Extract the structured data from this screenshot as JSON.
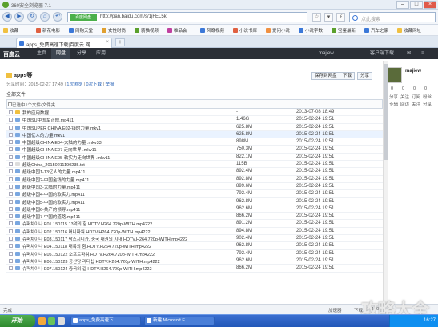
{
  "window": {
    "title": "360安全浏览器 7.1"
  },
  "address": {
    "secure_badge": "百度网盘",
    "url": "http://pan.baidu.com/s/1jFEL5k",
    "search_placeholder": "点此搜索"
  },
  "favorites": [
    "收藏",
    "新花电影",
    "网购天堂",
    "女性时尚",
    "骑猫视频",
    "唯品会",
    "风靡视频",
    "小说书库",
    "爱问小说",
    "小说字数",
    "宝鉴最新",
    "汽车之家",
    "收藏网址"
  ],
  "tab": {
    "label": "apps_免费高速下载|百度云 网"
  },
  "baidu_nav": {
    "logo": "百度云",
    "items": [
      "主页",
      "网盘",
      "分享",
      "应用"
    ],
    "active": 1,
    "user": "majiew",
    "right": [
      "客户端下载",
      "✉",
      "≡"
    ]
  },
  "share": {
    "title": "apps等",
    "meta_prefix": "分享时间：2015-02-27 17:49 | ",
    "meta_a": "1次浏览",
    "meta_b": "0次下载",
    "meta_c": "举报",
    "buttons": [
      "保存到网盘",
      "下载",
      "分享"
    ],
    "all_files": "全部文件",
    "selected": "已选中1个文件/文件夹"
  },
  "files": [
    {
      "name": "我的应用数据",
      "size": "-",
      "date": "2013-07-08 18:49",
      "color": "#f0c040",
      "hl": false
    },
    {
      "name": "中国SU中国军正规.mp411",
      "size": "1.46G",
      "date": "2015-02-24 19:51",
      "color": "#7aa7e0",
      "hl": false
    },
    {
      "name": "中国SUPER CHINA E02-钱的力量.mkv1",
      "size": "625.8M",
      "date": "2015-02-24 19:51",
      "color": "#7aa7e0",
      "hl": false
    },
    {
      "name": "中国亿人的力量.mkv1",
      "size": "625.8M",
      "date": "2015-02-24 19:51",
      "color": "#7aa7e0",
      "hl": true
    },
    {
      "name": "中国超级CHINA E04-大陆的力量 .mkv33",
      "size": "898M",
      "date": "2015-02-24 19:51",
      "color": "#7aa7e0",
      "hl": false
    },
    {
      "name": "中国超级CHINA E07 走向世界 .mkv11",
      "size": "750.3M",
      "date": "2015-02-24 19:51",
      "color": "#7aa7e0",
      "hl": false
    },
    {
      "name": "中国超级CHINA E05-软实力走向世界 .mkv11",
      "size": "822.1M",
      "date": "2015-02-24 19:51",
      "color": "#7aa7e0",
      "hl": false
    },
    {
      "name": "超级China_20150211190235.txt",
      "size": "115B",
      "date": "2015-02-24 19:51",
      "color": "#dddddd",
      "hl": false
    },
    {
      "name": "超级中国1-13亿人的力量.mp411",
      "size": "892.4M",
      "date": "2015-02-24 19:51",
      "color": "#7aa7e0",
      "hl": false
    },
    {
      "name": "超级中国2-中国金钱的力量.mp411",
      "size": "892.8M",
      "date": "2015-02-24 19:51",
      "color": "#7aa7e0",
      "hl": false
    },
    {
      "name": "超级中国3-大陆的力量.mp411",
      "size": "899.6M",
      "date": "2015-02-24 19:51",
      "color": "#7aa7e0",
      "hl": false
    },
    {
      "name": "超级中国4-中国的软实力.mp411",
      "size": "792.4M",
      "date": "2015-02-24 19:51",
      "color": "#7aa7e0",
      "hl": false
    },
    {
      "name": "超级中国5-中国的软实力.mp411",
      "size": "962.8M",
      "date": "2015-02-24 19:51",
      "color": "#7aa7e0",
      "hl": false
    },
    {
      "name": "超级中国6-共产的领导.mp411",
      "size": "962.6M",
      "date": "2015-02-24 19:51",
      "color": "#7aa7e0",
      "hl": false
    },
    {
      "name": "超级中国7-中国的道路.mp411",
      "size": "866.2M",
      "date": "2015-02-24 19:51",
      "color": "#7aa7e0",
      "hl": false
    },
    {
      "name": "슈퍼차이나 E01.150115 13억의 힘.HDTV.H264.720p-WITH.mp4222",
      "size": "891.2M",
      "date": "2015-02-24 19:51",
      "color": "#7aa7e0",
      "hl": false
    },
    {
      "name": "슈퍼차이나 E02.150116 머니파워.HDTV.H264.720p-WITH.mp4222",
      "size": "894.8M",
      "date": "2015-02-24 19:51",
      "color": "#7aa7e0",
      "hl": false
    },
    {
      "name": "슈퍼차이나 E03.150117 팍스시니카, 중국 패권의 시대 HDTV.H264.720p-WITH.mp4222",
      "size": "902.4M",
      "date": "2015-02-24 19:51",
      "color": "#7aa7e0",
      "hl": false
    },
    {
      "name": "슈퍼차이나 E04.150118 대륙의 힘.HDTV.H264.720p-WITH.mp4222",
      "size": "962.8M",
      "date": "2015-02-24 19:51",
      "color": "#7aa7e0",
      "hl": false
    },
    {
      "name": "슈퍼차이나 E05.150122 소프트파워.HDTV.H264.720p-WITH.mp4222",
      "size": "792.4M",
      "date": "2015-02-24 19:51",
      "color": "#7aa7e0",
      "hl": false
    },
    {
      "name": "슈퍼차이나 E06.150123 공산당 리더십 HDTV.H264.720p-WITH.mp4222",
      "size": "962.6M",
      "date": "2015-02-24 19:51",
      "color": "#7aa7e0",
      "hl": false
    },
    {
      "name": "슈퍼차이나 E07.150124 중국의 길 HDTV.H264.720p-WITH.mp4222",
      "size": "866.2M",
      "date": "2015-02-24 19:51",
      "color": "#7aa7e0",
      "hl": false
    }
  ],
  "profile": {
    "name": "majiew",
    "stats": [
      "0",
      "0",
      "0",
      "0",
      "分享",
      "关注",
      "订阅",
      "粉丝",
      "专辑",
      "回访",
      "关注",
      "分享"
    ]
  },
  "status": {
    "left": "完成",
    "right_a": "加速器",
    "right_b": "下载",
    "right_c": "100%"
  },
  "taskbar": {
    "start": "开始",
    "items": [
      "apps_免费高速下",
      "新建 Microsoft E"
    ],
    "tray": "16:27"
  },
  "watermark": "攻略大全"
}
